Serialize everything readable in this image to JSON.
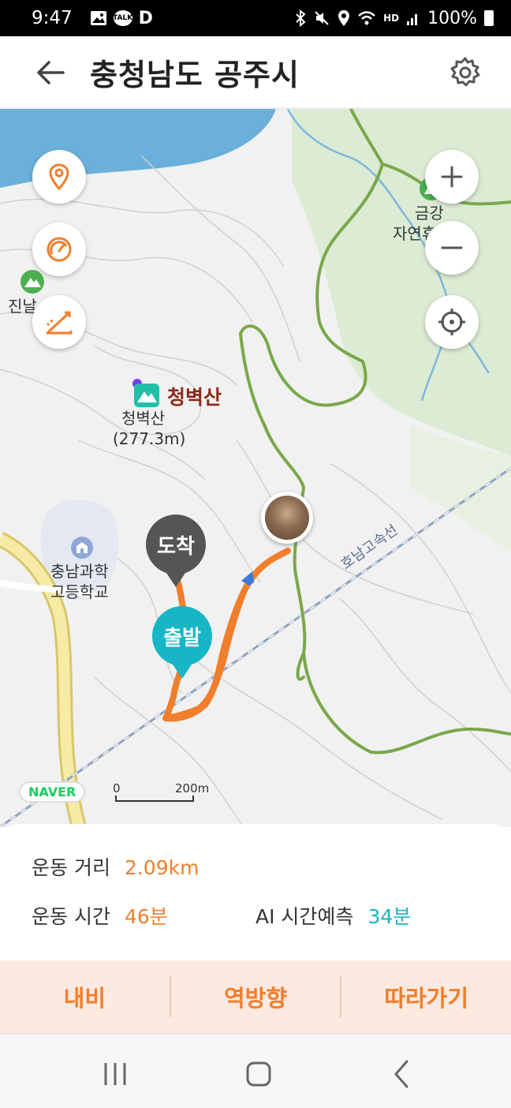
{
  "status_bar": {
    "time": "9:47",
    "talk_badge": "TALK",
    "d_badge": "D",
    "network": "HD",
    "battery": "100%",
    "icons": [
      "gallery-icon",
      "talk-icon",
      "d-app-icon",
      "bluetooth-icon",
      "mute-icon",
      "location-icon",
      "wifi-icon",
      "signal-icon",
      "battery-icon"
    ]
  },
  "header": {
    "title": "충청남도 공주시",
    "back_icon": "arrow-left-icon",
    "settings_icon": "gear-icon"
  },
  "map": {
    "labels": {
      "peak_name": "청벽산",
      "peak_sub": "청벽산",
      "peak_height": "(277.3m)",
      "school_line1": "충남과학",
      "school_line2": "고등학교",
      "highway": "호남고속선",
      "forest_line1": "금강",
      "forest_line2": "자연휴",
      "left_label": "진날"
    },
    "pins": {
      "arrive": "도착",
      "depart": "출발"
    },
    "naver": "NAVER",
    "scale": {
      "start": "0",
      "end": "200m"
    },
    "controls": {
      "zoom_in": "+",
      "zoom_out": "−"
    },
    "colors": {
      "route": "#f07e2c",
      "trail": "#7aa84a",
      "water": "#5fa9d6",
      "forest": "#dcebd3"
    }
  },
  "stats": {
    "distance_label": "운동 거리",
    "distance_value": "2.09km",
    "time_label": "운동 시간",
    "time_value": "46분",
    "ai_label": "AI 시간예측",
    "ai_value": "34분"
  },
  "actions": {
    "navi": "내비",
    "reverse": "역방향",
    "follow": "따라가기"
  },
  "system_nav": {
    "recent_icon": "recent-apps-icon",
    "home_icon": "home-icon",
    "back_icon": "back-chevron-icon"
  }
}
